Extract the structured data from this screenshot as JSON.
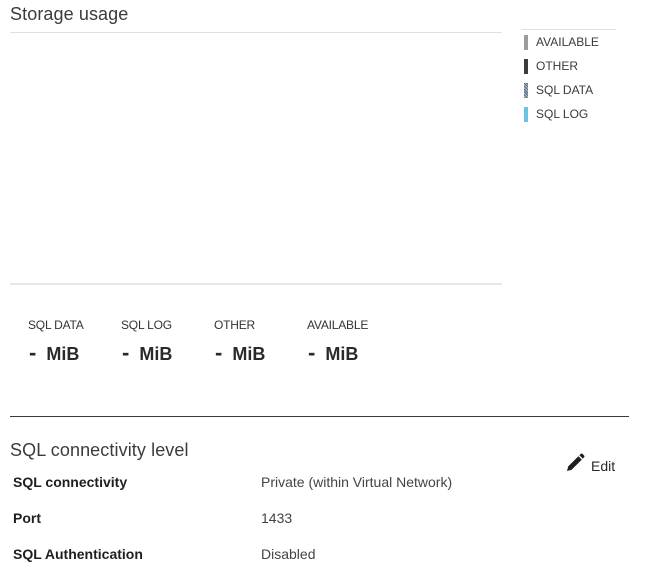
{
  "storage": {
    "title": "Storage usage",
    "legend": [
      {
        "label": "AVAILABLE",
        "color": "#9c9c9c"
      },
      {
        "label": "OTHER",
        "color": "#3c3c3c"
      },
      {
        "label": "SQL DATA",
        "color": "#7a8ea3"
      },
      {
        "label": "SQL LOG",
        "color": "#6cc3e6"
      }
    ],
    "stats": [
      {
        "label": "SQL DATA",
        "value": "-",
        "unit": "MiB"
      },
      {
        "label": "SQL LOG",
        "value": "-",
        "unit": "MiB"
      },
      {
        "label": "OTHER",
        "value": "-",
        "unit": "MiB"
      },
      {
        "label": "AVAILABLE",
        "value": "-",
        "unit": "MiB"
      }
    ]
  },
  "connectivity": {
    "title": "SQL connectivity level",
    "edit_label": "Edit",
    "edit_icon": "pencil-icon",
    "rows": [
      {
        "key": "SQL connectivity",
        "value": "Private (within Virtual Network)"
      },
      {
        "key": "Port",
        "value": "1433"
      },
      {
        "key": "SQL Authentication",
        "value": "Disabled"
      }
    ]
  }
}
